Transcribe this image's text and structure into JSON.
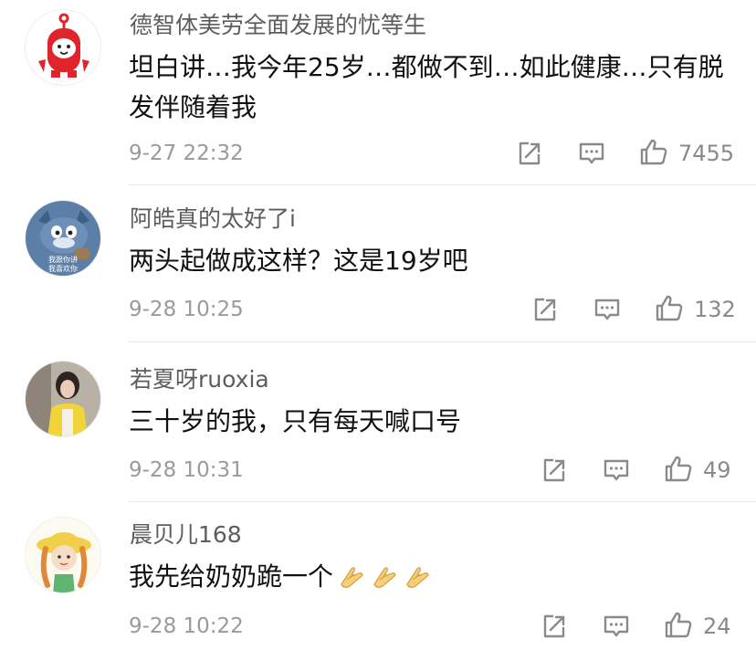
{
  "comments": [
    {
      "username": "德智体美劳全面发展的忧等生",
      "text": "坦白讲…我今年25岁…都做不到…如此健康…只有脱发伴随着我",
      "time": "9-27 22:32",
      "likes": "7455",
      "avatar_icon": "red-mascot-avatar"
    },
    {
      "username": "阿皓真的太好了i",
      "text": "两头起做成这样？这是19岁吧",
      "time": "9-28 10:25",
      "likes": "132",
      "avatar_icon": "cartoon-cat-avatar",
      "avatar_caption_1": "我跟你讲",
      "avatar_caption_2": "我喜欢你"
    },
    {
      "username": "若夏呀ruoxia",
      "text": "三十岁的我，只有每天喊口号",
      "time": "9-28 10:31",
      "likes": "49",
      "avatar_icon": "photo-person-avatar"
    },
    {
      "username": "晨贝儿168",
      "text": "我先给奶奶跪一个",
      "time": "9-28 10:22",
      "likes": "24",
      "avatar_icon": "cartoon-girl-avatar",
      "emojis": [
        "folded-hands-icon",
        "folded-hands-icon",
        "folded-hands-icon"
      ]
    }
  ],
  "colors": {
    "name": "#5d5d5d",
    "text": "#111111",
    "meta": "#9a9a9a",
    "icon": "#8a8a8a",
    "divider": "#e9e9e9"
  }
}
